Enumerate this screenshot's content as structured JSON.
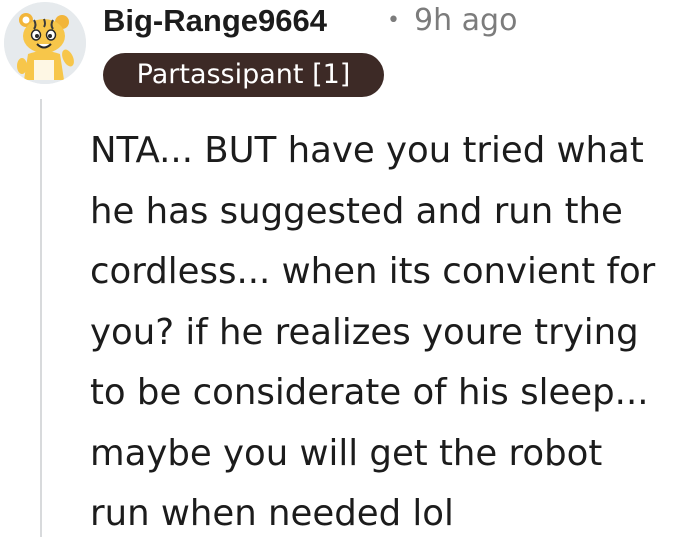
{
  "comment": {
    "author": "Big-Range9664",
    "separator": "•",
    "time_ago": "9h ago",
    "flair": "Partassipant [1]",
    "avatar_icon": "snoo-avatar-icon",
    "body": "NTA... BUT have you tried what\nhe has suggested and run the\ncordless... when its convient for\nyou? if he realizes youre trying\nto be considerate of his sleep...\nmaybe you will get the robot\nrun when needed lol"
  },
  "colors": {
    "flair_bg": "#3d2a26",
    "text": "#1c1c1c",
    "meta": "#7c7c7c",
    "thread_line": "#d8dadc"
  }
}
